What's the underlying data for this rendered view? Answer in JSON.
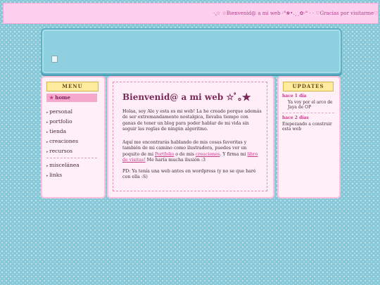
{
  "marquee": {
    "text": "·.̩͙☆ ☆Bienvenid@ a mi web ·°❀•.¸¸✿·° · · ♡Gracias por visitarme♡ · · ·.̩͙☆··Insta :"
  },
  "menu": {
    "title": "MENU",
    "home": "home",
    "items": [
      "personal",
      "portfolio",
      "tienda",
      "creaciones",
      "recursos"
    ],
    "items2": [
      "miscelánea",
      "links"
    ]
  },
  "main": {
    "title": "Bienvenid@ a mi web ☆ﾟ｡★",
    "para1": "Holaa, soy Ale y esta es mi web!      La he creado porque además de ser extremandamente nostalgica, llevaba tiempo con ganas de tener un blog para poder hablar de mi vida sin seguir las reglas de ningún algoritmo.",
    "para2_a": "Aquí me encontrarás hablando de mis cosas favoritas y también de mi camino como ilustradora, puedes ver un poquito de mi ",
    "link_portfolio": "Portfolio",
    "para2_b": " o de mis ",
    "link_creaciones": "creaciones",
    "para2_c": ". Y firma mi ",
    "link_visitas": "libro de visitas!",
    "para2_d": " Me haría mucha ilusión :3",
    "para3": "PD: Ya tenía una web antes en wordpress (y no se que haré con ella :S)"
  },
  "updates": {
    "title": "UPDATES",
    "entries": [
      {
        "date": "hace 1 día",
        "text": "Ya voy por el arco de Jaya de OP"
      },
      {
        "date": "hace 2 días",
        "text": "Empezando a construir esta web"
      }
    ]
  }
}
